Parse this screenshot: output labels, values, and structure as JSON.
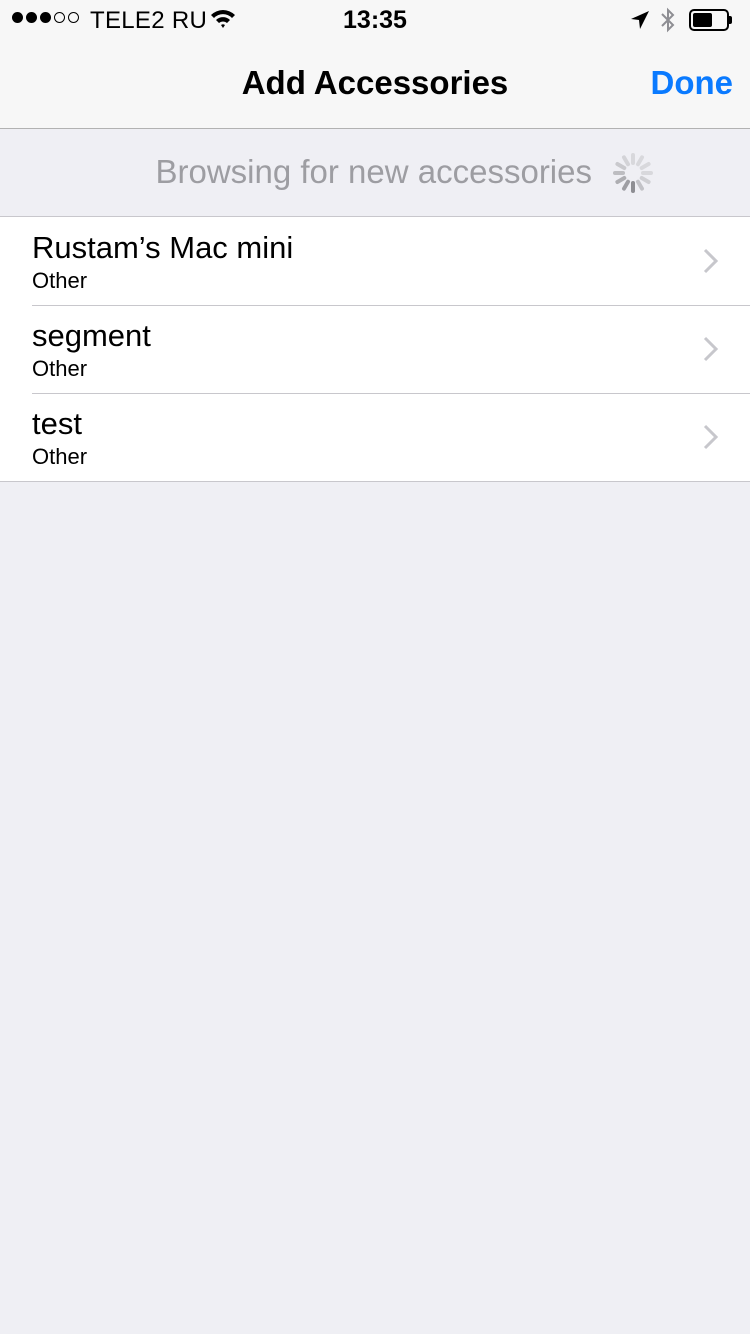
{
  "status_bar": {
    "carrier": "TELE2 RU",
    "time": "13:35",
    "signal_bars_filled": 3,
    "signal_bars_total": 5,
    "battery_level": 0.5,
    "icons": [
      "wifi-icon",
      "location-arrow-icon",
      "bluetooth-icon",
      "battery-icon"
    ]
  },
  "navbar": {
    "title": "Add Accessories",
    "done_label": "Done"
  },
  "browsing": {
    "text": "Browsing for new accessories",
    "icon": "activity-spinner-icon"
  },
  "accessories": [
    {
      "name": "Rustam’s Mac mini",
      "category": "Other"
    },
    {
      "name": "segment",
      "category": "Other"
    },
    {
      "name": "test",
      "category": "Other"
    }
  ],
  "colors": {
    "accent": "#0a7aff",
    "background": "#efeff4",
    "secondary_text": "#9d9da2"
  }
}
